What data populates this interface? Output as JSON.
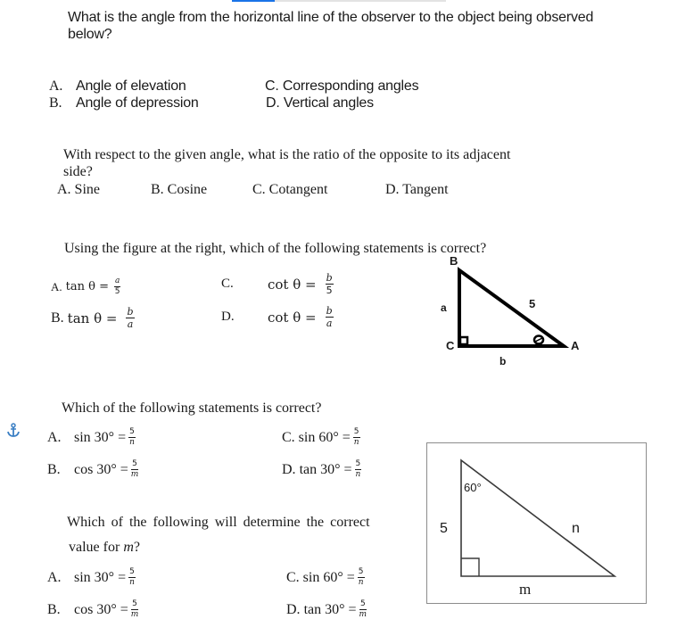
{
  "progress": {
    "percent": 20,
    "fill_color": "#1a73e8",
    "track_color": "#e3e3e3"
  },
  "q1": {
    "question_line1": "What is the angle from the horizontal line of the observer to the object being observed",
    "question_line2": "below?",
    "options": [
      {
        "letter": "A.",
        "text": "Angle of elevation"
      },
      {
        "letter": "B.",
        "text": "Angle of depression"
      },
      {
        "letter": "C.",
        "text": "Corresponding angles"
      },
      {
        "letter": "D.",
        "text": "Vertical angles"
      }
    ]
  },
  "q2": {
    "question_line1": "With respect to the given angle, what is the ratio of the opposite to its adjacent",
    "question_line2": "side?",
    "options": [
      {
        "label": "A. Sine"
      },
      {
        "label": "B.  Cosine"
      },
      {
        "label": "C. Cotangent"
      },
      {
        "label": "D. Tangent"
      }
    ]
  },
  "q3": {
    "question": "Using the figure at the right, which of the following statements is correct?",
    "options": [
      {
        "letter": "A.",
        "lhs": "tan θ =",
        "num": "a",
        "den": "5"
      },
      {
        "letter": "B.",
        "lhs": "tan θ =",
        "num": "b",
        "den": "a"
      },
      {
        "letter": "C.",
        "lhs": "cot θ =",
        "num": "b",
        "den": "5"
      },
      {
        "letter": "D.",
        "lhs": "cot θ =",
        "num": "b",
        "den": "a"
      }
    ],
    "figure": {
      "vertex_labels": {
        "top": "B",
        "right_angle": "C",
        "acute": "A"
      },
      "side_labels": {
        "vertical": "a",
        "hypotenuse": "5",
        "horizontal": "b"
      },
      "angle_mark": "θ"
    }
  },
  "q4": {
    "question": "Which of the following statements is correct?",
    "options": [
      {
        "letter": "A.",
        "lhs": "sin 30° =",
        "num": "5",
        "den": "n"
      },
      {
        "letter": "B.",
        "lhs": "cos 30° =",
        "num": "5",
        "den": "m"
      },
      {
        "letter": "C.",
        "lhs": "sin 60° =",
        "num": "5",
        "den": "n"
      },
      {
        "letter": "D.",
        "lhs": "tan 30° =",
        "num": "5",
        "den": "n"
      }
    ]
  },
  "q5": {
    "question_line1": "Which of the following will determine the correct",
    "question_line2_prefix": "value for ",
    "question_line2_var": "m",
    "question_line2_suffix": "?",
    "options": [
      {
        "letter": "A.",
        "lhs": "sin 30° =",
        "num": "5",
        "den": "n"
      },
      {
        "letter": "B.",
        "lhs": "cos 30° =",
        "num": "5",
        "den": "m"
      },
      {
        "letter": "C.",
        "lhs": "sin 60° =",
        "num": "5",
        "den": "n"
      },
      {
        "letter": "D.",
        "lhs": "tan 30° =",
        "num": "5",
        "den": "m"
      }
    ],
    "figure": {
      "angle_label": "60°",
      "side_labels": {
        "vertical": "5",
        "hypotenuse": "n",
        "horizontal": "m"
      }
    }
  },
  "icons": {
    "anchor": "anchor-icon"
  }
}
